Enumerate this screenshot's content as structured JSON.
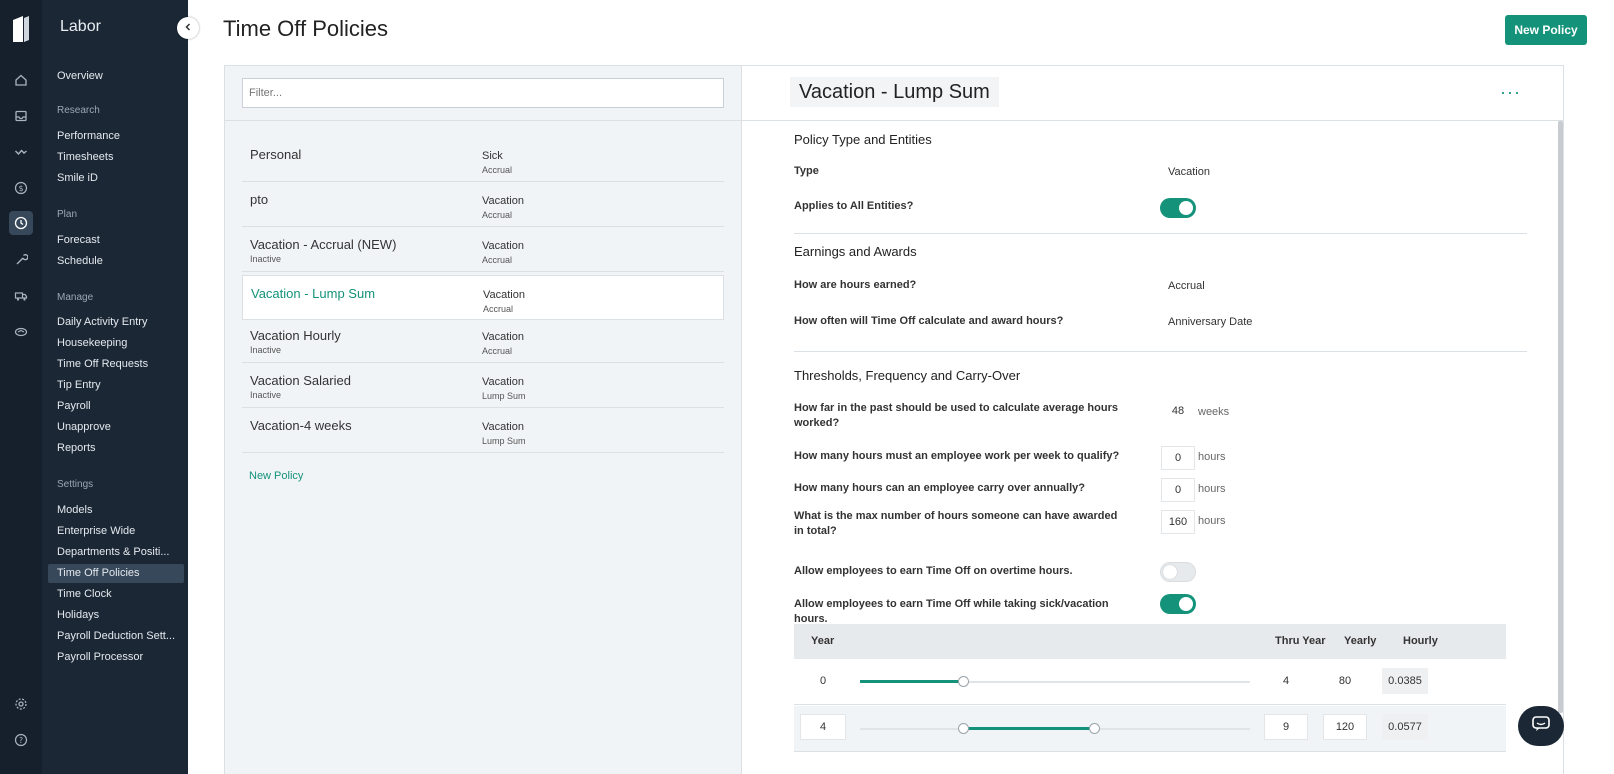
{
  "app": {
    "section_title": "Labor"
  },
  "sidebar": {
    "groups": [
      {
        "label": "",
        "items": [
          {
            "label": "Overview"
          }
        ]
      },
      {
        "label": "Research",
        "items": [
          {
            "label": "Performance"
          },
          {
            "label": "Timesheets"
          },
          {
            "label": "Smile iD"
          }
        ]
      },
      {
        "label": "Plan",
        "items": [
          {
            "label": "Forecast"
          },
          {
            "label": "Schedule"
          }
        ]
      },
      {
        "label": "Manage",
        "items": [
          {
            "label": "Daily Activity Entry"
          },
          {
            "label": "Housekeeping"
          },
          {
            "label": "Time Off Requests"
          },
          {
            "label": "Tip Entry"
          },
          {
            "label": "Payroll"
          },
          {
            "label": "Unapprove"
          },
          {
            "label": "Reports"
          }
        ]
      },
      {
        "label": "Settings",
        "items": [
          {
            "label": "Models"
          },
          {
            "label": "Enterprise Wide"
          },
          {
            "label": "Departments & Positi..."
          },
          {
            "label": "Time Off Policies"
          },
          {
            "label": "Time Clock"
          },
          {
            "label": "Holidays"
          },
          {
            "label": "Payroll Deduction Sett..."
          },
          {
            "label": "Payroll Processor"
          }
        ]
      }
    ],
    "active": "Time Off Policies"
  },
  "header": {
    "title": "Time Off Policies",
    "new_button": "New Policy"
  },
  "policy_list": {
    "filter_placeholder": "Filter...",
    "items": [
      {
        "name": "Personal",
        "status": "",
        "type": "Sick",
        "subtype": "Accrual"
      },
      {
        "name": "pto",
        "status": "",
        "type": "Vacation",
        "subtype": "Accrual"
      },
      {
        "name": "Vacation - Accrual (NEW)",
        "status": "Inactive",
        "type": "Vacation",
        "subtype": "Accrual"
      },
      {
        "name": "Vacation - Lump Sum",
        "status": "",
        "type": "Vacation",
        "subtype": "Accrual",
        "selected": true
      },
      {
        "name": "Vacation Hourly",
        "status": "Inactive",
        "type": "Vacation",
        "subtype": "Accrual"
      },
      {
        "name": "Vacation Salaried",
        "status": "Inactive",
        "type": "Vacation",
        "subtype": "Lump Sum"
      },
      {
        "name": "Vacation-4 weeks",
        "status": "",
        "type": "Vacation",
        "subtype": "Lump Sum"
      }
    ],
    "new_link": "New Policy"
  },
  "detail": {
    "title": "Vacation - Lump Sum",
    "more_icon": "···",
    "policy_section": {
      "heading": "Policy Type and Entities",
      "type_label": "Type",
      "type_value": "Vacation",
      "applies_label": "Applies to All Entities?",
      "applies_on": true
    },
    "earnings_section": {
      "heading": "Earnings and Awards",
      "earned_label": "How are hours earned?",
      "earned_value": "Accrual",
      "often_label": "How often will Time Off calculate and award hours?",
      "often_value": "Anniversary Date"
    },
    "thresholds_section": {
      "heading": "Thresholds, Frequency and Carry-Over",
      "past_label": "How far in the past should be used to calculate average hours worked?",
      "past_value": "48",
      "past_unit": "weeks",
      "qualify_label": "How many hours must an employee work per week to qualify?",
      "qualify_value": "0",
      "qualify_unit": "hours",
      "carry_label": "How many hours can an employee carry over annually?",
      "carry_value": "0",
      "carry_unit": "hours",
      "max_label": "What is the max number of hours someone can have awarded in total?",
      "max_value": "160",
      "max_unit": "hours",
      "overtime_label": "Allow employees to earn Time Off on overtime hours.",
      "overtime_on": false,
      "sick_label": "Allow employees to earn Time Off while taking sick/vacation hours.",
      "sick_on": true
    },
    "table": {
      "headers": {
        "year": "Year",
        "thru": "Thru Year",
        "yearly": "Yearly",
        "hourly": "Hourly"
      },
      "rows": [
        {
          "year": "0",
          "thru": "4",
          "yearly": "80",
          "hourly": "0.0385"
        },
        {
          "year": "4",
          "thru": "9",
          "yearly": "120",
          "hourly": "0.0577"
        }
      ]
    }
  }
}
